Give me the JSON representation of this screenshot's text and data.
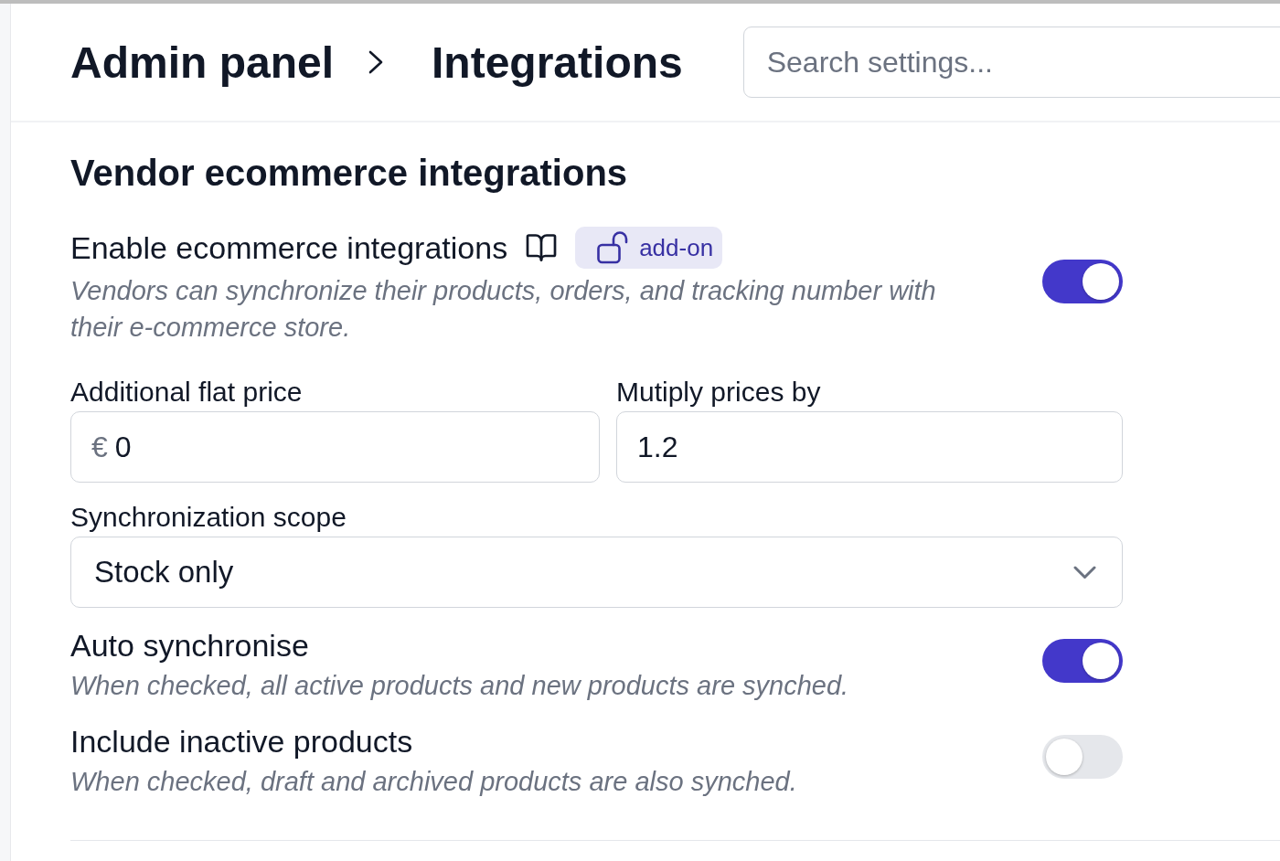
{
  "header": {
    "breadcrumb": [
      {
        "label": "Admin panel"
      },
      {
        "label": "Integrations"
      }
    ],
    "search": {
      "placeholder": "Search settings..."
    }
  },
  "section": {
    "title": "Vendor ecommerce integrations",
    "settings": [
      {
        "kind": "toggle",
        "label": "Enable ecommerce integrations",
        "has_docs_link": true,
        "badge": "add-on",
        "description": "Vendors can synchronize their products, orders, and tracking number with their e-commerce store.",
        "on": true
      },
      {
        "kind": "inputs",
        "fields": [
          {
            "label": "Additional flat price",
            "prefix": "€",
            "value": "0"
          },
          {
            "label": "Mutiply prices by",
            "value": "1.2"
          }
        ]
      },
      {
        "kind": "select",
        "label": "Synchronization scope",
        "value": "Stock only"
      },
      {
        "kind": "toggle",
        "label": "Auto synchronise",
        "description": "When checked, all active products and new products are synched.",
        "on": true
      },
      {
        "kind": "toggle",
        "label": "Include inactive products",
        "description": "When checked, draft and archived products are also synched.",
        "on": false
      }
    ]
  }
}
